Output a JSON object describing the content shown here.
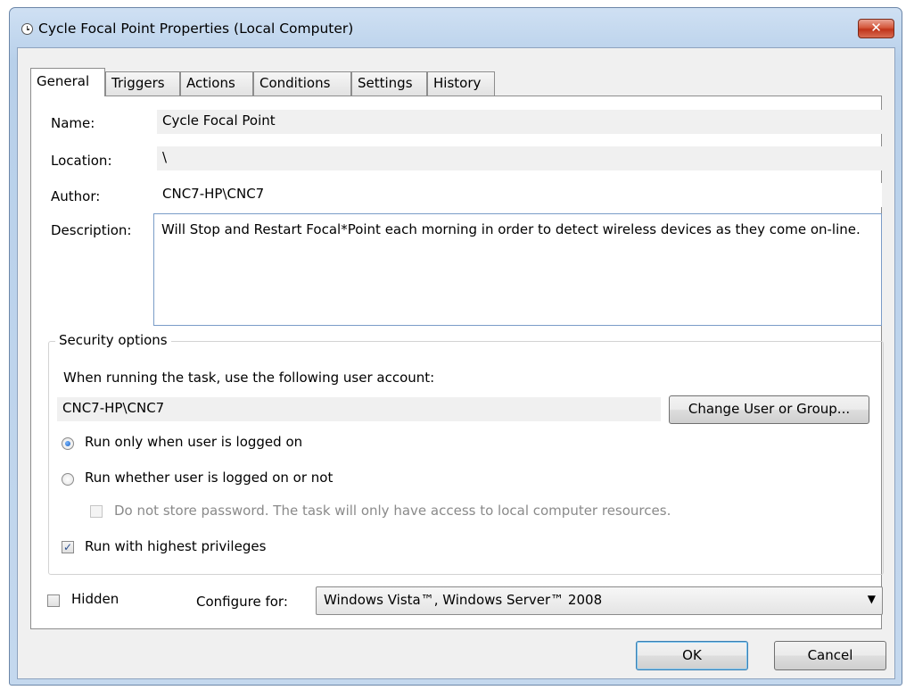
{
  "window": {
    "title": "Cycle Focal Point Properties (Local Computer)",
    "close_glyph": "✕"
  },
  "tabs": [
    {
      "label": "General"
    },
    {
      "label": "Triggers"
    },
    {
      "label": "Actions"
    },
    {
      "label": "Conditions"
    },
    {
      "label": "Settings"
    },
    {
      "label": "History"
    }
  ],
  "general": {
    "name_label": "Name:",
    "name_value": "Cycle Focal Point",
    "location_label": "Location:",
    "location_value": "\\",
    "author_label": "Author:",
    "author_value": "CNC7-HP\\CNC7",
    "description_label": "Description:",
    "description_value": "Will Stop and Restart Focal*Point each morning in order to detect wireless devices as they come on-line."
  },
  "security": {
    "group_title": "Security options",
    "account_prompt": "When running the task, use the following user account:",
    "account_value": "CNC7-HP\\CNC7",
    "change_button": "Change User or Group...",
    "radio_logged_on": "Run only when user is logged on",
    "radio_logged_on_checked": true,
    "radio_whether": "Run whether user is logged on or not",
    "radio_whether_checked": false,
    "no_store_password": "Do not store password.  The task will only have access to local computer resources.",
    "highest_privileges": "Run with highest privileges",
    "highest_privileges_checked": true
  },
  "footer": {
    "hidden_label": "Hidden",
    "hidden_checked": false,
    "configure_label": "Configure for:",
    "configure_value": "Windows Vista™, Windows Server™ 2008"
  },
  "buttons": {
    "ok": "OK",
    "cancel": "Cancel"
  }
}
